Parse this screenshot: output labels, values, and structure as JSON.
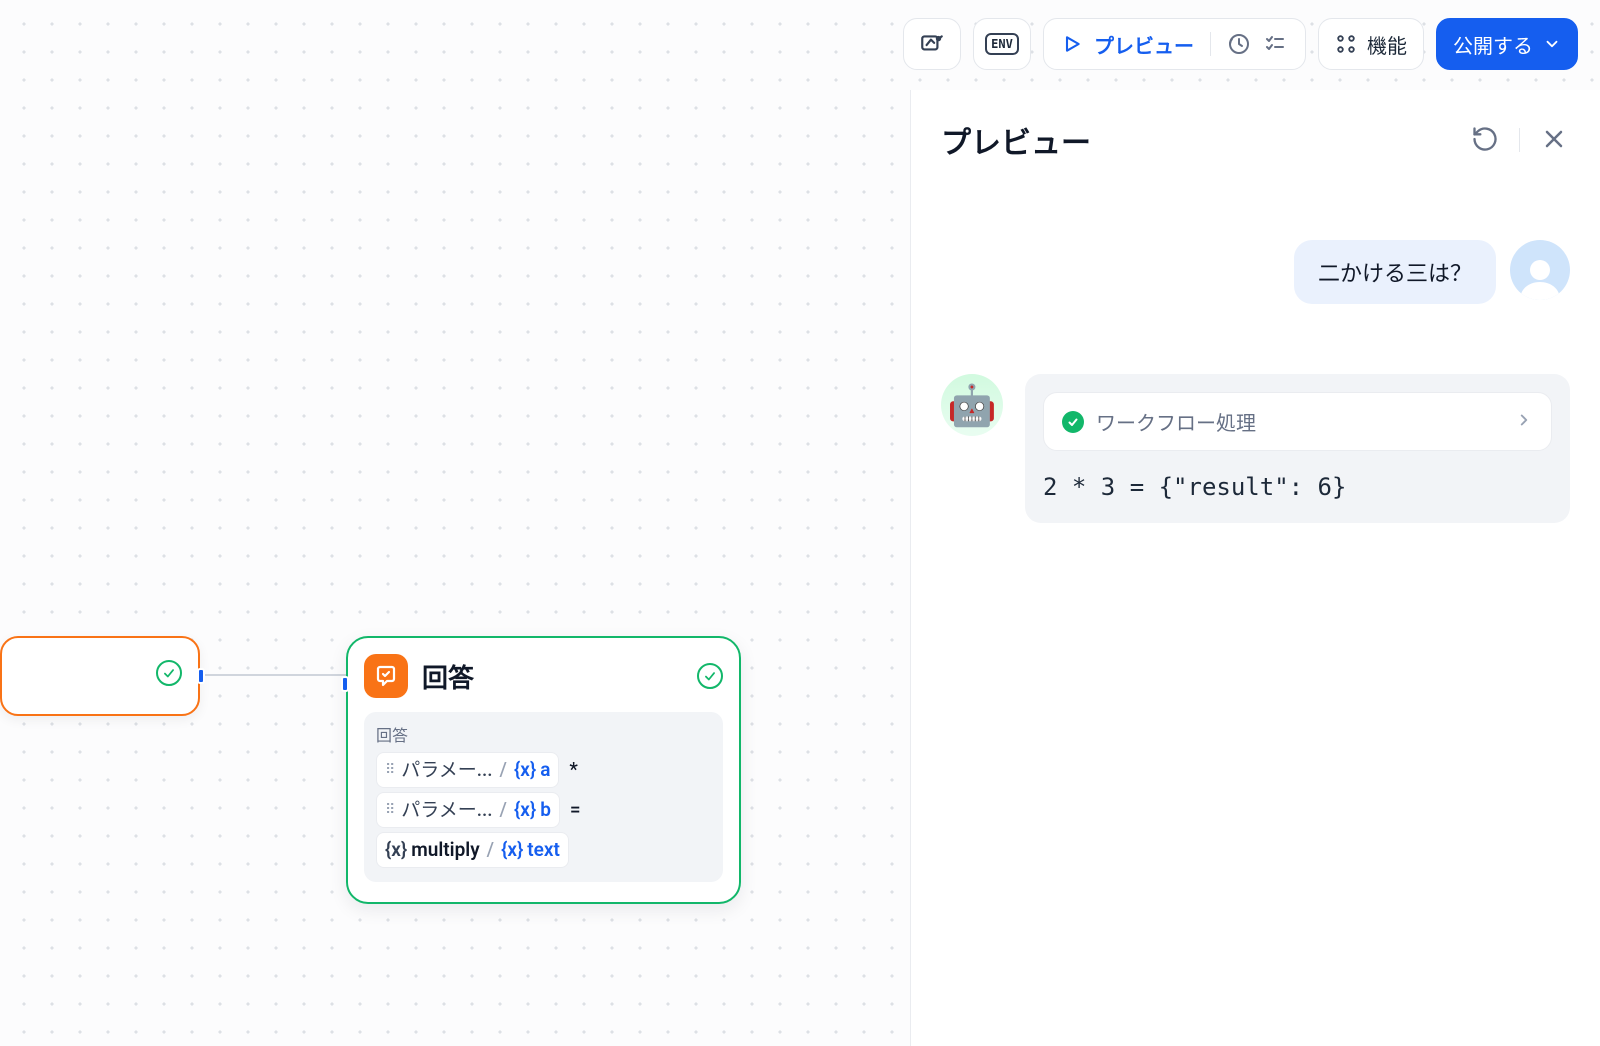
{
  "toolbar": {
    "preview_label": "プレビュー",
    "features_label": "機能",
    "publish_label": "公開する"
  },
  "canvas": {
    "answer_node": {
      "title": "回答",
      "body_label": "回答",
      "rows": [
        {
          "source": "パラメー...",
          "var": "a",
          "op": "*"
        },
        {
          "source": "パラメー...",
          "var": "b",
          "op": "="
        }
      ],
      "result_row": {
        "func": "multiply",
        "var": "text"
      }
    }
  },
  "panel": {
    "title": "プレビュー",
    "chat": {
      "user_message": "二かける三は？",
      "bot": {
        "workflow_status_label": "ワークフロー処理",
        "response_text": "2 * 3 = {\"result\": 6}",
        "avatar_emoji": "🤖"
      }
    }
  }
}
